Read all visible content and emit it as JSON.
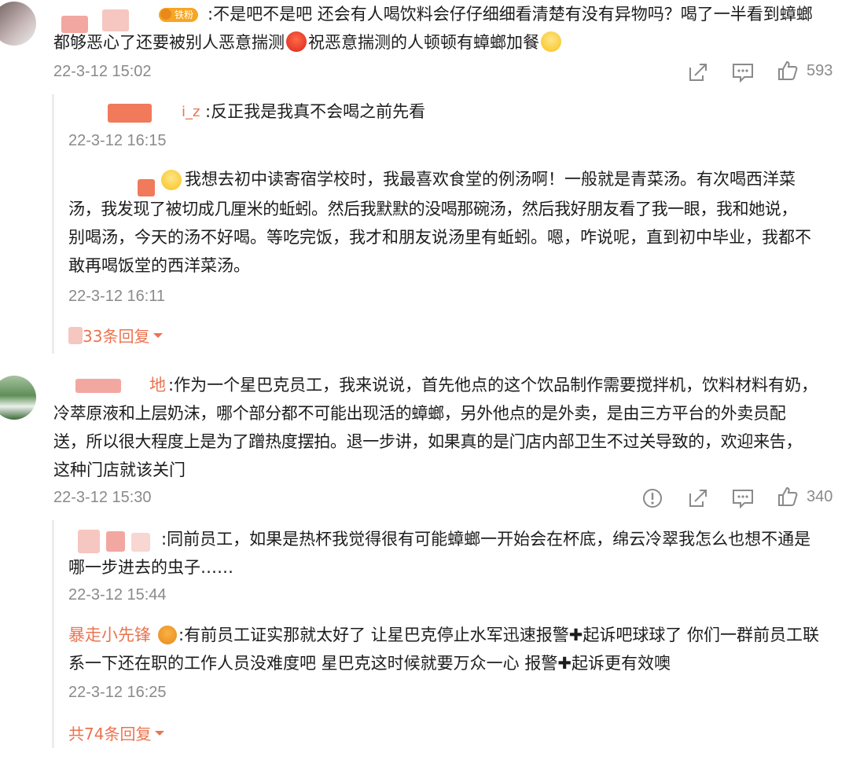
{
  "comments": [
    {
      "badge": "铁粉",
      "text_line1": ":不是吧不是吧 还会有人喝饮料会仔仔细细看清楚有没有异物吗？喝了一半看到蟑螂",
      "text_line2a": "都够恶心了还要被别人恶意揣测",
      "text_line2b": "祝恶意揣测的人顿顿有蟑螂加餐",
      "time": "22-3-12 15:02",
      "likes": "593",
      "replies": [
        {
          "name_suffix": "i_z",
          "text": ":反正我是我真不会喝之前先看",
          "time": "22-3-12 16:15"
        },
        {
          "line1": "我想去初中读寄宿学校时，我最喜欢食堂的例汤啊！一般就是青菜汤。有次喝西洋菜",
          "line2": "汤，我发现了被切成几厘米的蚯蚓。然后我默默的没喝那碗汤，然后我好朋友看了我一眼，我和她说，",
          "line3": "别喝汤，今天的汤不好喝。等吃完饭，我才和朋友说汤里有蚯蚓。嗯，咋说呢，直到初中毕业，我都不",
          "line4": "敢再喝饭堂的西洋菜汤。",
          "time": "22-3-12 16:11"
        }
      ],
      "more_replies": "33条回复"
    },
    {
      "name_suffix": "地",
      "line1": ":作为一个星巴克员工，我来说说，首先他点的这个饮品制作需要搅拌机，饮料材料有奶，",
      "line2": "冷萃原液和上层奶沫，哪个部分都不可能出现活的蟑螂，另外他点的是外卖，是由三方平台的外卖员配",
      "line3": "送，所以很大程度上是为了蹭热度摆拍。退一步讲，如果真的是门店内部卫生不过关导致的，欢迎来告，",
      "line4": "这种门店就该关门",
      "time": "22-3-12 15:30",
      "likes": "340",
      "replies": [
        {
          "line1": ":同前员工，如果是热杯我觉得很有可能蟑螂一开始会在杯底，绵云冷翠我怎么也想不通是",
          "line2": "哪一步进去的虫子……",
          "time": "22-3-12 15:44"
        },
        {
          "name": "暴走小先锋",
          "line1": ":有前员工证实那就太好了 让星巴克停止水军迅速报警✚起诉吧球球了 你们一群前员工联",
          "line2": "系一下还在职的工作人员没难度吧 星巴克这时候就要万众一心 报警✚起诉更有效噢",
          "time": "22-3-12 16:25"
        }
      ],
      "more_replies": "共74条回复"
    }
  ],
  "colors": {
    "accent": "#eb7350",
    "muted": "#8a8a8a",
    "badge": "#f6a623"
  },
  "icons": [
    "share-icon",
    "comment-icon",
    "like-icon",
    "report-icon",
    "dropdown-icon"
  ]
}
